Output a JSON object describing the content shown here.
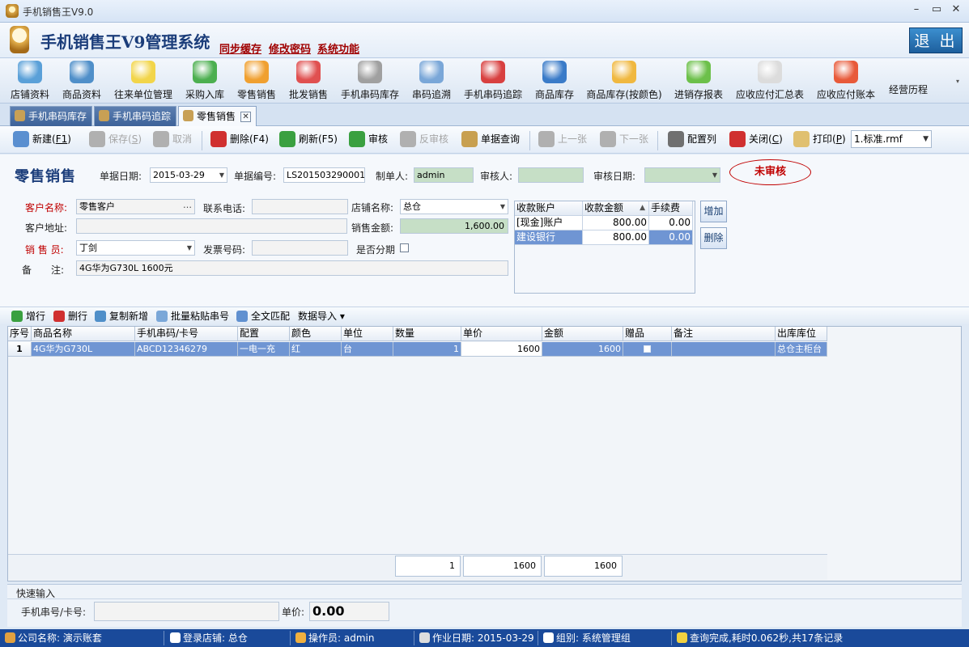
{
  "window": {
    "title": "手机销售王V9.0",
    "controls": [
      "–",
      "▭",
      "✕"
    ]
  },
  "banner": {
    "app_title": "手机销售王V9管理系统",
    "links": [
      "同步缓存",
      "修改密码",
      "系统功能"
    ],
    "exit_label": "退 出"
  },
  "main_toolbar": [
    {
      "label": "店铺资料",
      "color": "#5aa0d8"
    },
    {
      "label": "商品资料",
      "color": "#4f8fc9"
    },
    {
      "label": "往来单位管理",
      "color": "#f2d54a"
    },
    {
      "label": "采购入库",
      "color": "#4caf50"
    },
    {
      "label": "零售销售",
      "color": "#f0a030"
    },
    {
      "label": "批发销售",
      "color": "#e05050"
    },
    {
      "label": "手机串码库存",
      "color": "#a0a0a0"
    },
    {
      "label": "串码追溯",
      "color": "#7aa7d8"
    },
    {
      "label": "手机串码追踪",
      "color": "#d84040"
    },
    {
      "label": "商品库存",
      "color": "#3a7bc8"
    },
    {
      "label": "商品库存(按颜色)",
      "color": "#f0b840"
    },
    {
      "label": "进销存报表",
      "color": "#6cc04a"
    },
    {
      "label": "应收应付汇总表",
      "color": "#dcdcdc"
    },
    {
      "label": "应收应付账本",
      "color": "#e85a3a"
    },
    {
      "label": "经营历程",
      "color": ""
    }
  ],
  "tabs": [
    {
      "label": "手机串码库存",
      "active": false
    },
    {
      "label": "手机串码追踪",
      "active": false
    },
    {
      "label": "零售销售",
      "active": true,
      "close": "✕"
    }
  ],
  "toolbar2": [
    {
      "label": "新建(",
      "key": "F1",
      "tail": ")",
      "disabled": false,
      "color": "#5a8fd0"
    },
    {
      "label": "保存(",
      "key": "S",
      "tail": ")",
      "disabled": true,
      "color": "#b0b0b0"
    },
    {
      "label": "取消",
      "key": "",
      "tail": "",
      "disabled": true,
      "color": "#b0b0b0"
    },
    {
      "label": "删除(F4)",
      "key": "",
      "tail": "",
      "disabled": false,
      "color": "#d03030"
    },
    {
      "label": "刷新(F5)",
      "key": "",
      "tail": "",
      "disabled": false,
      "color": "#3aa040"
    },
    {
      "label": "审核",
      "key": "",
      "tail": "",
      "disabled": false,
      "color": "#3aa040"
    },
    {
      "label": "反审核",
      "key": "",
      "tail": "",
      "disabled": true,
      "color": "#b0b0b0"
    },
    {
      "label": "单据查询",
      "key": "",
      "tail": "",
      "disabled": false,
      "color": "#c8a050"
    },
    {
      "label": "上一张",
      "key": "",
      "tail": "",
      "disabled": true,
      "color": "#b0b0b0"
    },
    {
      "label": "下一张",
      "key": "",
      "tail": "",
      "disabled": true,
      "color": "#b0b0b0"
    },
    {
      "label": "配置列",
      "key": "",
      "tail": "",
      "disabled": false,
      "color": "#707070"
    },
    {
      "label": "关闭(",
      "key": "C",
      "tail": ")",
      "disabled": false,
      "color": "#d03030"
    },
    {
      "label": "打印(",
      "key": "P",
      "tail": ")",
      "disabled": false,
      "color": "#e0c070"
    }
  ],
  "template_select": "1.标准.rmf",
  "form": {
    "title": "零售销售",
    "date_label": "单据日期:",
    "date_value": "2015-03-29",
    "docno_label": "单据编号:",
    "docno_value": "LS201503290001",
    "maker_label": "制单人:",
    "maker_value": "admin",
    "auditor_label": "审核人:",
    "auditor_value": "",
    "auditdate_label": "审核日期:",
    "auditdate_value": "",
    "status_stamp": "未审核",
    "customer_label": "客户名称:",
    "customer_value": "零售客户",
    "customer_btn": "…",
    "phone_label": "联系电话:",
    "phone_value": "",
    "store_label": "店铺名称:",
    "store_value": "总仓",
    "address_label": "客户地址:",
    "address_value": "",
    "amount_label": "销售金额:",
    "amount_value": "1,600.00",
    "seller_label": "销 售 员:",
    "seller_value": "丁剑",
    "invoice_label": "发票号码:",
    "invoice_value": "",
    "installment_label": "是否分期",
    "remark_label": "备　　注:",
    "remark_value": "4G华为G730L 1600元"
  },
  "payments": {
    "headers": [
      "收款账户",
      "收款金额",
      "手续费"
    ],
    "sort_indicator": "▲",
    "rows": [
      {
        "account": "[现金]账户",
        "amount": "800.00",
        "fee": "0.00"
      },
      {
        "account": "建设银行",
        "amount": "800.00",
        "fee": "0.00"
      }
    ],
    "add_label": "增加",
    "del_label": "删除"
  },
  "grid_toolbar": [
    {
      "label": "增行",
      "color": "#3aa040"
    },
    {
      "label": "删行",
      "color": "#d03030"
    },
    {
      "label": "复制新增",
      "color": "#4f8fc9"
    },
    {
      "label": "批量粘贴串号",
      "color": "#7aa7d8"
    },
    {
      "label": "全文匹配",
      "color": "#6090d0"
    },
    {
      "label": "数据导入 ▾",
      "color": ""
    }
  ],
  "grid": {
    "headers": [
      "序号",
      "商品名称",
      "手机串码/卡号",
      "配置",
      "颜色",
      "单位",
      "数量",
      "单价",
      "金额",
      "赠品",
      "备注",
      "出库库位"
    ],
    "rows": [
      [
        "1",
        "4G华为G730L",
        "ABCD12346279",
        "一电一充",
        "红",
        "台",
        "1",
        "1600",
        "1600",
        "",
        "",
        "总仓主柜台"
      ]
    ],
    "totals": {
      "qty": "1",
      "price": "1600",
      "amount": "1600"
    }
  },
  "quick_input": {
    "title": "快速输入",
    "serial_label": "手机串号/卡号:",
    "serial_value": "",
    "price_label": "单价:",
    "price_value": "0.00"
  },
  "statusbar": [
    {
      "text": "公司名称: 演示账套",
      "color": "#e0a040"
    },
    {
      "text": "登录店铺: 总仓",
      "color": "#ffffff"
    },
    {
      "text": "操作员: admin",
      "color": "#f0b040"
    },
    {
      "text": "作业日期: 2015-03-29",
      "color": "#dddddd"
    },
    {
      "text": "组别: 系统管理组",
      "color": "#ffffff"
    },
    {
      "text": "查询完成,耗时0.062秒,共17条记录",
      "color": "#f0d040"
    }
  ]
}
